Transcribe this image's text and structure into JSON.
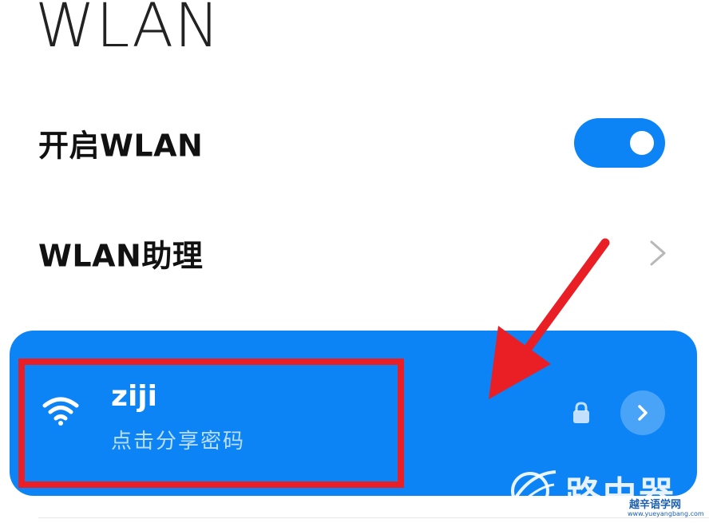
{
  "header": {
    "title": "WLAN"
  },
  "settings": {
    "enable_wlan": {
      "label": "开启WLAN",
      "enabled": true
    },
    "wlan_assistant": {
      "label": "WLAN助理"
    }
  },
  "current_network": {
    "name": "ziji",
    "subtitle": "点击分享密码",
    "secured": true
  },
  "watermark": {
    "big_text": "路由器",
    "site_name": "越辛语学网",
    "url": "www.yueyangbang.com"
  },
  "colors": {
    "accent": "#0c84f5",
    "annotation_red": "#ea1f26"
  },
  "icons": [
    "wifi-icon",
    "lock-icon",
    "chevron-right-icon",
    "arrow-annotation"
  ]
}
